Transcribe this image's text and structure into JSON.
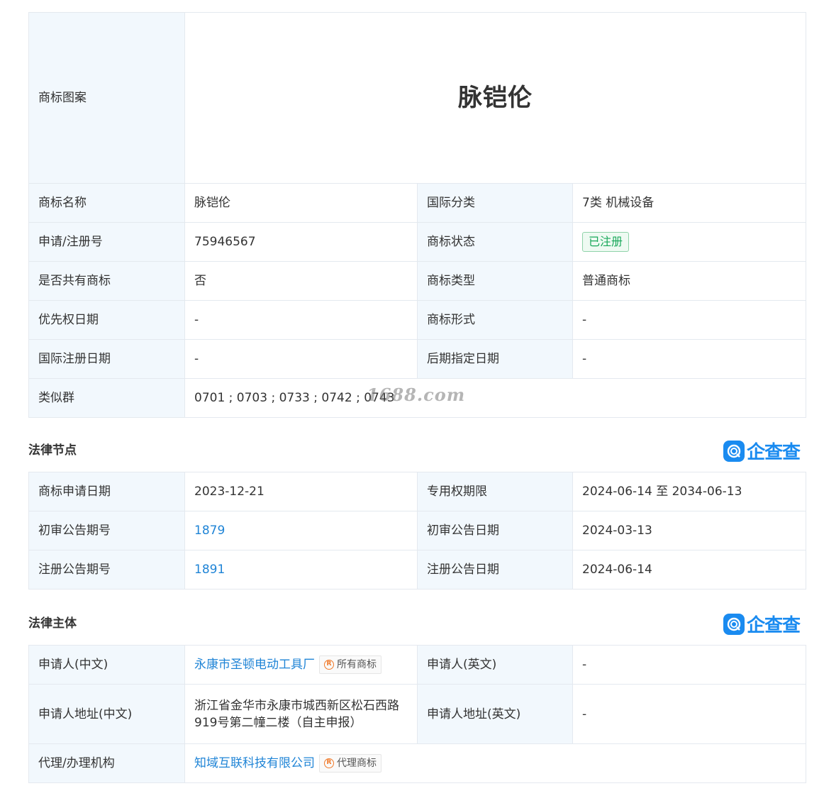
{
  "main": {
    "logo_label": "商标图案",
    "logo_text": "脉铠伦",
    "rows": [
      {
        "l1": "商标名称",
        "v1": "脉铠伦",
        "l2": "国际分类",
        "v2": "7类 机械设备"
      },
      {
        "l1": "申请/注册号",
        "v1": "75946567",
        "l2": "商标状态",
        "v2": "已注册"
      },
      {
        "l1": "是否共有商标",
        "v1": "否",
        "l2": "商标类型",
        "v2": "普通商标"
      },
      {
        "l1": "优先权日期",
        "v1": "-",
        "l2": "商标形式",
        "v2": "-"
      },
      {
        "l1": "国际注册日期",
        "v1": "-",
        "l2": "后期指定日期",
        "v2": "-"
      }
    ],
    "similar_label": "类似群",
    "similar_value": "0701 ; 0703 ; 0733 ; 0742 ; 0743"
  },
  "watermark": "1688.com",
  "legal": {
    "title": "法律节点",
    "brand": "企查查",
    "rows": [
      {
        "l1": "商标申请日期",
        "v1": "2023-12-21",
        "l2": "专用权期限",
        "v2": "2024-06-14 至 2034-06-13"
      },
      {
        "l1": "初审公告期号",
        "v1": "1879",
        "l2": "初审公告日期",
        "v2": "2024-03-13"
      },
      {
        "l1": "注册公告期号",
        "v1": "1891",
        "l2": "注册公告日期",
        "v2": "2024-06-14"
      }
    ]
  },
  "entity": {
    "title": "法律主体",
    "brand": "企查查",
    "applicant_cn_label": "申请人(中文)",
    "applicant_cn": "永康市圣顿电动工具厂",
    "applicant_cn_chip": "所有商标",
    "applicant_en_label": "申请人(英文)",
    "applicant_en": "-",
    "address_cn_label": "申请人地址(中文)",
    "address_cn": "浙江省金华市永康市城西新区松石西路919号第二幢二楼（自主申报）",
    "address_en_label": "申请人地址(英文)",
    "address_en": "-",
    "agent_label": "代理/办理机构",
    "agent": "知域互联科技有限公司",
    "agent_chip": "代理商标"
  },
  "colors": {
    "label_bg": "#f2f8fd",
    "border": "#e4e9ef",
    "link": "#1f84d6",
    "status_green": "#19a85a",
    "brand_blue": "#1a8bf0",
    "chip_icon_orange": "#f07a2b"
  },
  "icons": [
    "qcc-logo-icon",
    "registered-r-icon"
  ]
}
